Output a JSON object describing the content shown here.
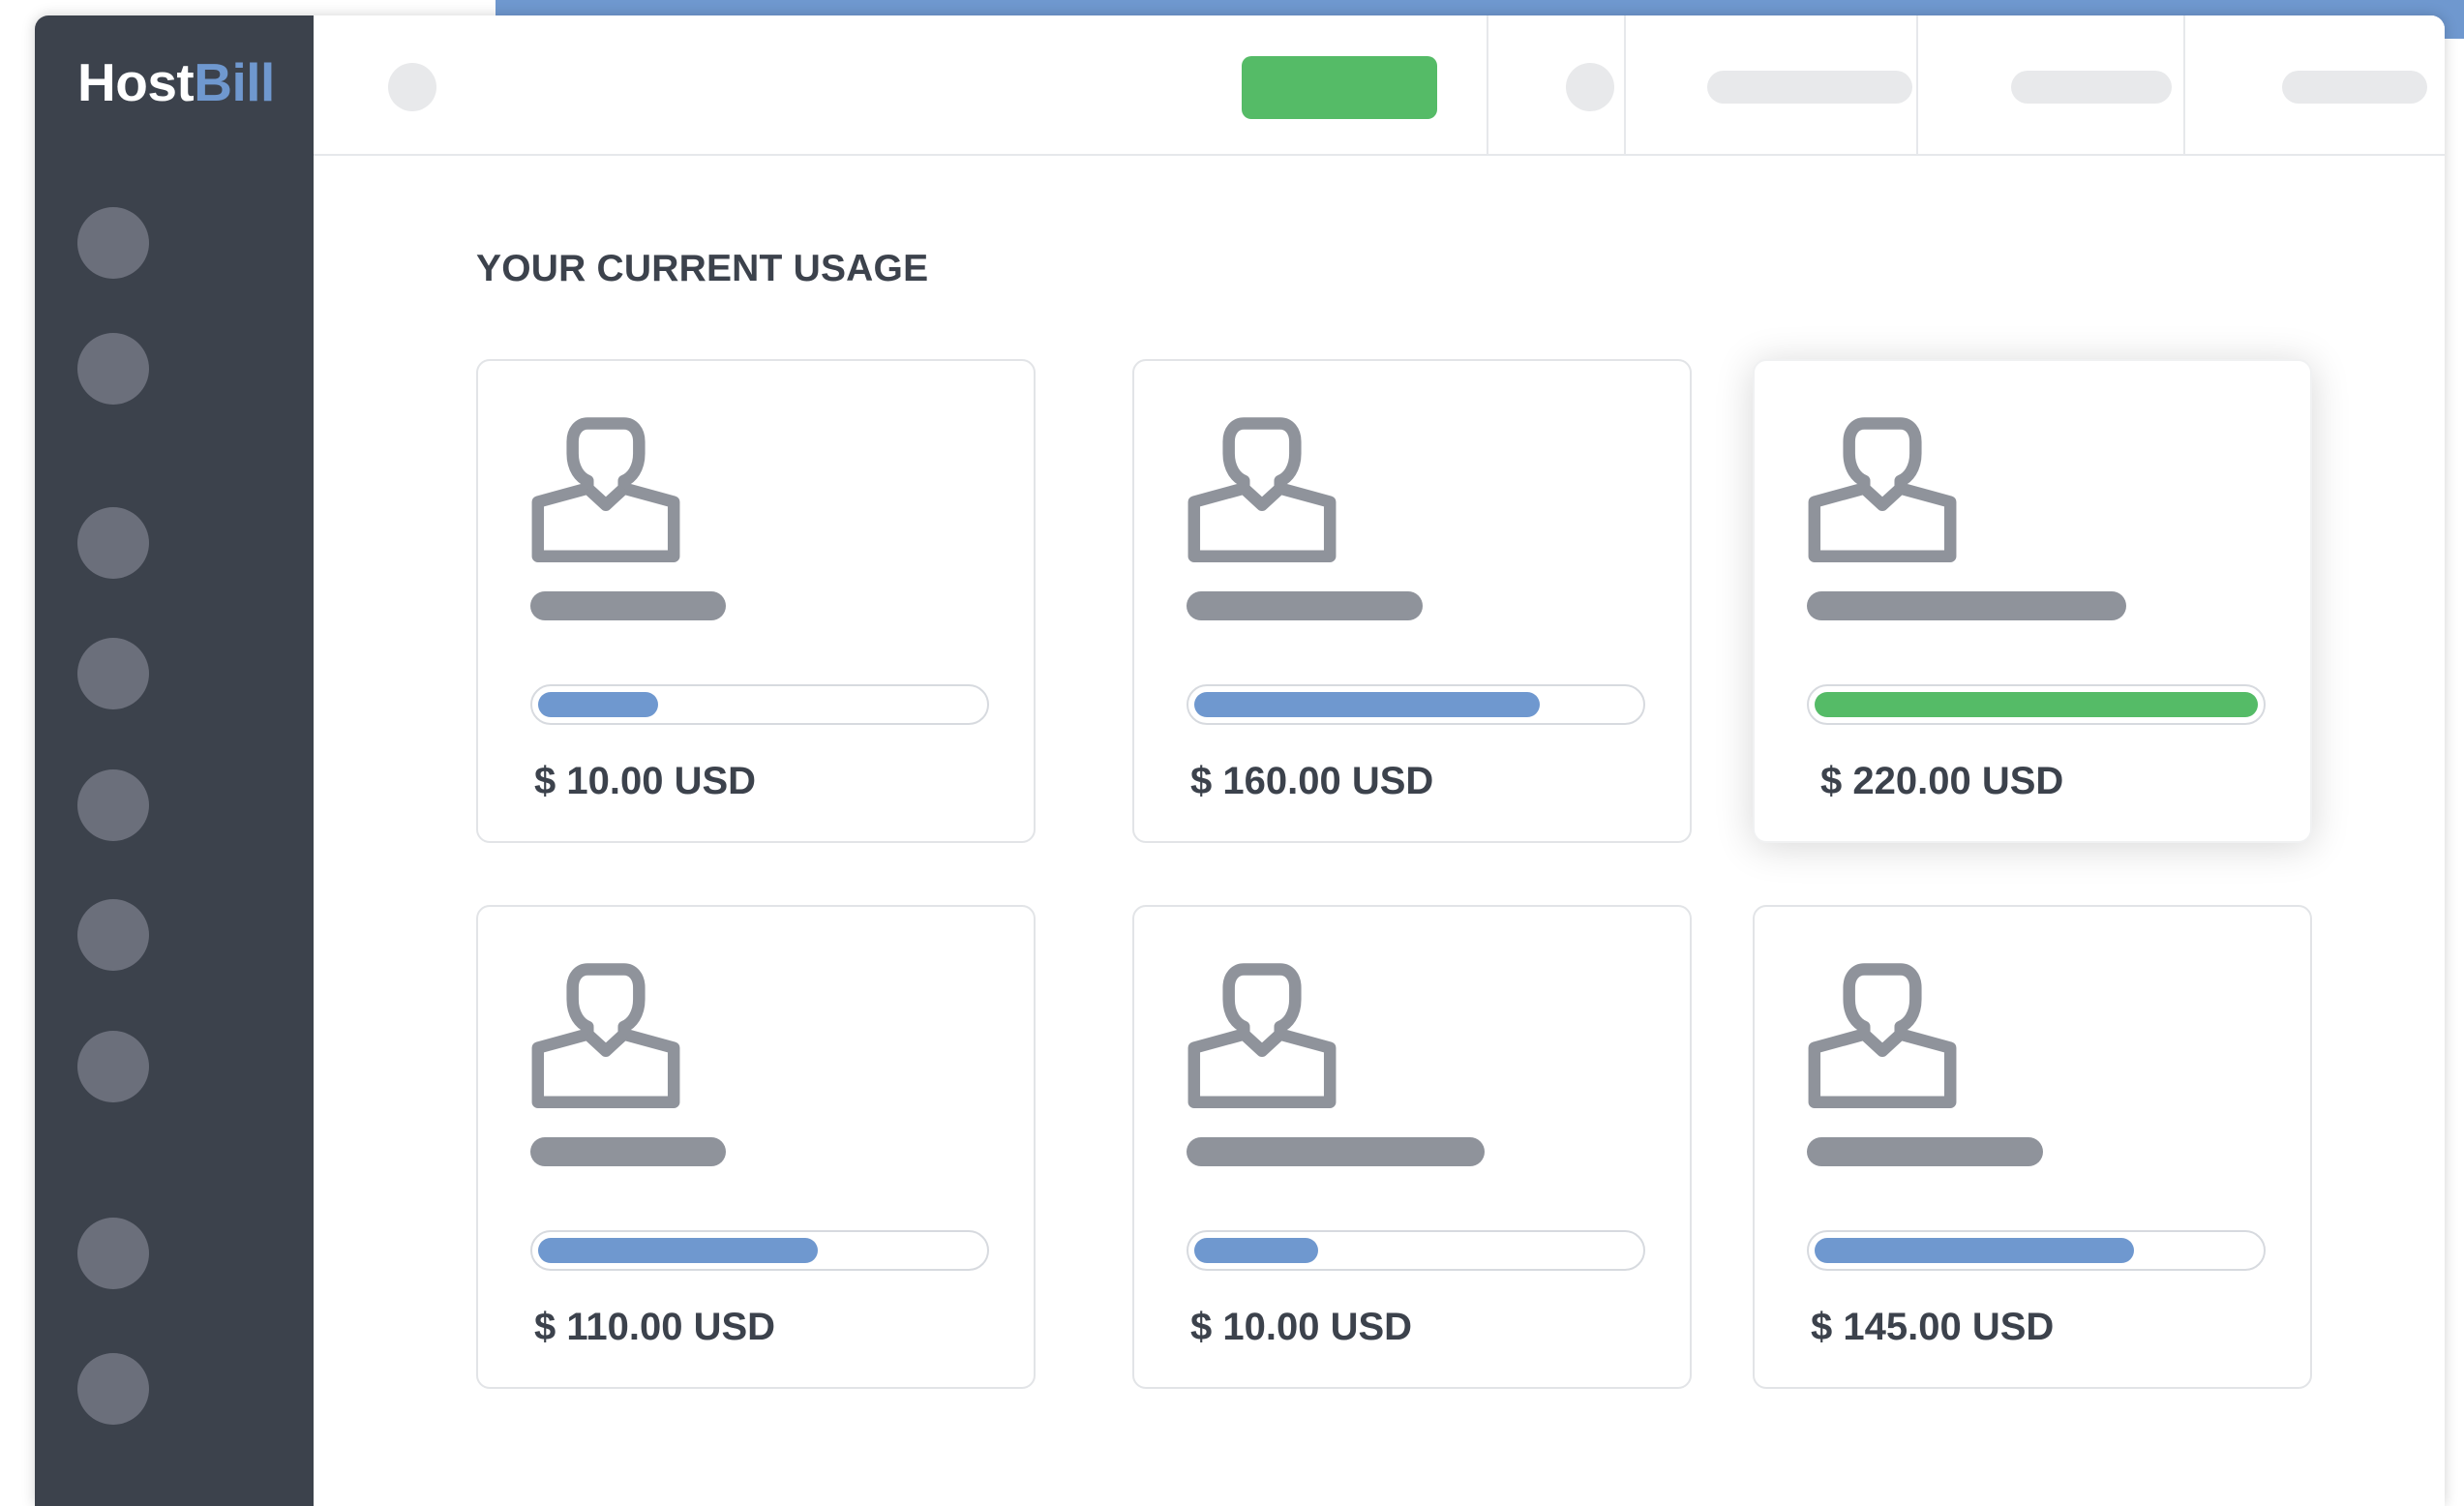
{
  "app": {
    "logo_part1": "Host",
    "logo_part2": "Bill",
    "colors": {
      "sidebar": "#3c424c",
      "accent_blue": "#6f98cf",
      "accent_green": "#55bb67",
      "placeholder": "#8f939b"
    }
  },
  "main": {
    "section_title": "YOUR CURRENT USAGE",
    "cards": [
      {
        "amount": "$ 10.00 USD",
        "progress": 0.27,
        "bar_color": "#6f98cf",
        "icon": "user-icon"
      },
      {
        "amount": "$ 160.00 USD",
        "progress": 0.78,
        "bar_color": "#6f98cf",
        "icon": "user-icon"
      },
      {
        "amount": "$ 220.00 USD",
        "progress": 1.0,
        "bar_color": "#55bb67",
        "icon": "user-icon"
      },
      {
        "amount": "$ 110.00 USD",
        "progress": 0.63,
        "bar_color": "#6f98cf",
        "icon": "user-icon"
      },
      {
        "amount": "$ 10.00 USD",
        "progress": 0.28,
        "bar_color": "#6f98cf",
        "icon": "user-icon"
      },
      {
        "amount": "$ 145.00 USD",
        "progress": 0.72,
        "bar_color": "#6f98cf",
        "icon": "user-icon"
      }
    ]
  }
}
